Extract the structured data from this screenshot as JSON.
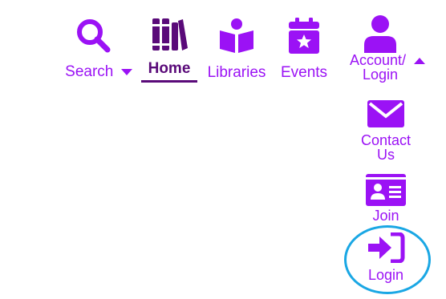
{
  "nav": {
    "search_label": "Search",
    "home_label": "Home",
    "libraries_label": "Libraries",
    "events_label": "Events",
    "account_label_line1": "Account/",
    "account_label_line2": "Login"
  },
  "account_menu": {
    "contact_line1": "Contact",
    "contact_line2": "Us",
    "join_label": "Join",
    "login_label": "Login"
  },
  "colors": {
    "accent": "#9b12f5",
    "active": "#5a0a79",
    "highlight": "#1aa7e4",
    "background": "#ffffff"
  },
  "icons": {
    "search": "magnifier-icon",
    "home": "books-icon",
    "libraries": "reader-icon",
    "events": "calendar-star-icon",
    "account": "user-icon",
    "contact": "envelope-icon",
    "join": "id-card-icon",
    "login": "sign-in-icon"
  }
}
